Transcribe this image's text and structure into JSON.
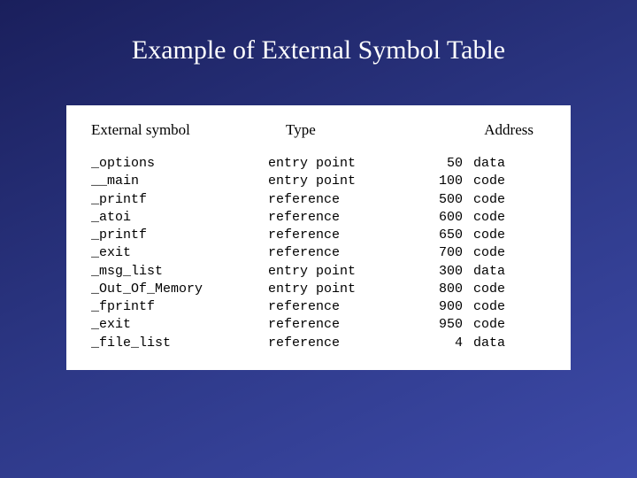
{
  "title": "Example of External Symbol Table",
  "headers": {
    "symbol": "External symbol",
    "type": "Type",
    "address": "Address"
  },
  "rows": [
    {
      "symbol": "_options",
      "type": "entry point",
      "address": "50",
      "seg": "data"
    },
    {
      "symbol": "__main",
      "type": "entry point",
      "address": "100",
      "seg": "code"
    },
    {
      "symbol": "_printf",
      "type": "reference",
      "address": "500",
      "seg": "code"
    },
    {
      "symbol": "_atoi",
      "type": "reference",
      "address": "600",
      "seg": "code"
    },
    {
      "symbol": "_printf",
      "type": "reference",
      "address": "650",
      "seg": "code"
    },
    {
      "symbol": "_exit",
      "type": "reference",
      "address": "700",
      "seg": "code"
    },
    {
      "symbol": "_msg_list",
      "type": "entry point",
      "address": "300",
      "seg": "data"
    },
    {
      "symbol": "_Out_Of_Memory",
      "type": "entry point",
      "address": "800",
      "seg": "code"
    },
    {
      "symbol": "_fprintf",
      "type": "reference",
      "address": "900",
      "seg": "code"
    },
    {
      "symbol": "_exit",
      "type": "reference",
      "address": "950",
      "seg": "code"
    },
    {
      "symbol": "_file_list",
      "type": "reference",
      "address": "4",
      "seg": "data"
    }
  ]
}
